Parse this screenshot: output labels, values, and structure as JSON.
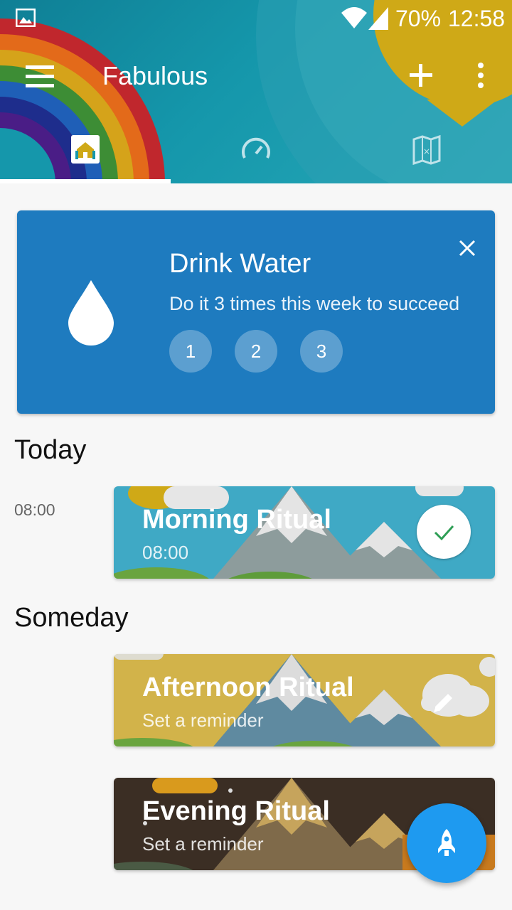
{
  "status_bar": {
    "battery": "70%",
    "time": "12:58",
    "icons": [
      "gallery-icon",
      "wifi-icon",
      "signal-icon"
    ]
  },
  "toolbar": {
    "title": "Fabulous",
    "icons": [
      "menu-icon",
      "add-icon",
      "more-vert-icon"
    ]
  },
  "tabs": [
    {
      "icon": "home-icon",
      "selected": true
    },
    {
      "icon": "speedometer-icon",
      "selected": false
    },
    {
      "icon": "map-icon",
      "selected": false
    }
  ],
  "goal_card": {
    "title": "Drink Water",
    "subtitle": "Do it 3 times this week to succeed",
    "steps": [
      "1",
      "2",
      "3"
    ],
    "icon": "water-drop-icon",
    "close_icon": "close-icon",
    "color": "#1e7bbf"
  },
  "today": {
    "heading": "Today",
    "time": "08:00",
    "ritual": {
      "title": "Morning Ritual",
      "subtitle": "08:00",
      "status_icon": "check-icon"
    }
  },
  "someday": {
    "heading": "Someday",
    "rituals": [
      {
        "title": "Afternoon Ritual",
        "subtitle": "Set a reminder",
        "icon": "edit-icon",
        "color": "#d2b34a"
      },
      {
        "title": "Evening Ritual",
        "subtitle": "Set a reminder",
        "color": "#3b2e24"
      }
    ]
  },
  "fab": {
    "icon": "rocket-icon",
    "color": "#1e9af0"
  },
  "colors": {
    "header": "#1597ab",
    "accent": "#1e9af0",
    "check": "#2e9e55"
  }
}
